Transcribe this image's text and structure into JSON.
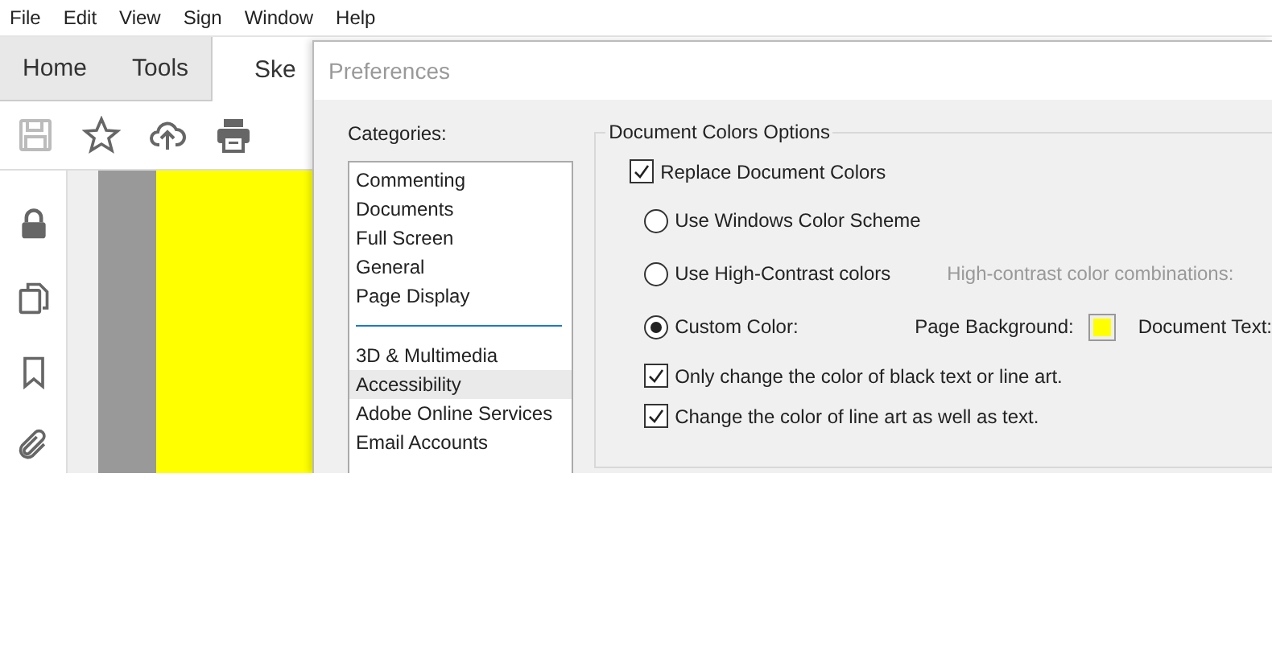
{
  "menu": [
    "File",
    "Edit",
    "View",
    "Sign",
    "Window",
    "Help"
  ],
  "tabs": [
    {
      "label": "Home",
      "selected": false
    },
    {
      "label": "Tools",
      "selected": false
    },
    {
      "label": "Ske",
      "selected": true
    }
  ],
  "toolbar": [
    {
      "kind": "save",
      "disabled": true
    },
    {
      "kind": "star",
      "disabled": false
    },
    {
      "kind": "upload",
      "disabled": false
    },
    {
      "kind": "print",
      "disabled": false
    }
  ],
  "left_rail": [
    {
      "kind": "lock"
    },
    {
      "kind": "copy"
    },
    {
      "kind": "bookmark"
    },
    {
      "kind": "attachment"
    }
  ],
  "dialog": {
    "title": "Preferences",
    "categories_label": "Categories:",
    "category_groups": [
      {
        "items": [
          {
            "label": "Commenting",
            "selected": false
          },
          {
            "label": "Documents",
            "selected": false
          },
          {
            "label": "Full Screen",
            "selected": false
          },
          {
            "label": "General",
            "selected": false
          },
          {
            "label": "Page Display",
            "selected": false
          }
        ]
      },
      {
        "items": [
          {
            "label": "3D & Multimedia",
            "selected": false
          },
          {
            "label": "Accessibility",
            "selected": true
          },
          {
            "label": "Adobe Online Services",
            "selected": false
          },
          {
            "label": "Email Accounts",
            "selected": false
          }
        ]
      }
    ],
    "options": {
      "title": "Document Colors Options",
      "replace": {
        "label": "Replace Document Colors",
        "checked": true
      },
      "radios": [
        {
          "label": "Use Windows Color Scheme",
          "selected": false
        },
        {
          "label": "Use High-Contrast colors",
          "selected": false,
          "hint": {
            "text": "High-contrast color combinations:",
            "disabled": true
          }
        },
        {
          "label": "Custom Color:",
          "selected": true,
          "colors": {
            "page_background_label": "Page Background:",
            "document_text_label": "Document Text:"
          }
        }
      ],
      "checkboxes": [
        {
          "label": "Only change the color of black text or line art.",
          "checked": true
        },
        {
          "label": "Change the color of line art as well as text.",
          "checked": true
        }
      ]
    }
  }
}
